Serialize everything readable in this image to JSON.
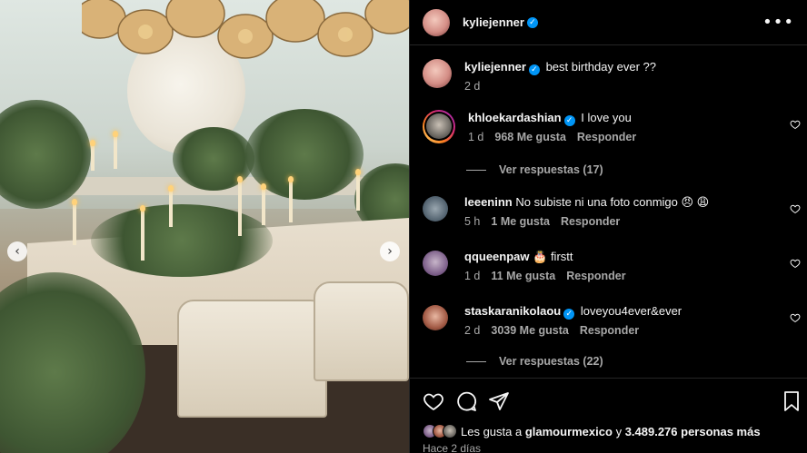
{
  "post": {
    "author": "kyliejenner",
    "caption": "best birthday ever ??",
    "caption_age": "2 d"
  },
  "comments": [
    {
      "user": "khloekardashian",
      "verified": true,
      "text": "I love you",
      "age": "1 d",
      "likes": "968 Me gusta",
      "reply": "Responder",
      "view_replies": "Ver respuestas (17)"
    },
    {
      "user": "leeeninn",
      "verified": false,
      "text": "No subiste ni una foto conmigo 😠 😩",
      "age": "5 h",
      "likes": "1 Me gusta",
      "reply": "Responder"
    },
    {
      "user": "qqueenpaw",
      "verified": false,
      "text": "🎂 firstt",
      "age": "1 d",
      "likes": "11 Me gusta",
      "reply": "Responder"
    },
    {
      "user": "staskaranikolaou",
      "verified": true,
      "text": "loveyou4ever&ever",
      "age": "2 d",
      "likes": "3039 Me gusta",
      "reply": "Responder",
      "view_replies": "Ver respuestas (22)"
    }
  ],
  "footer": {
    "likes_prefix": "Les gusta a",
    "likes_user": "glamourmexico",
    "likes_join": "y",
    "likes_count": "3.489.276 personas más",
    "posted_ago": "Hace 2 días"
  },
  "icons": {
    "like": "heart-icon",
    "comment": "comment-icon",
    "share": "send-icon",
    "save": "bookmark-icon",
    "more": "more-options-icon",
    "verified": "verified-badge-icon",
    "prev": "chevron-left-icon",
    "next": "chevron-right-icon"
  },
  "colors": {
    "background": "#000000",
    "text": "#f5f5f5",
    "muted": "#a8a8a8",
    "verified": "#0095f6",
    "divider": "#262626"
  }
}
